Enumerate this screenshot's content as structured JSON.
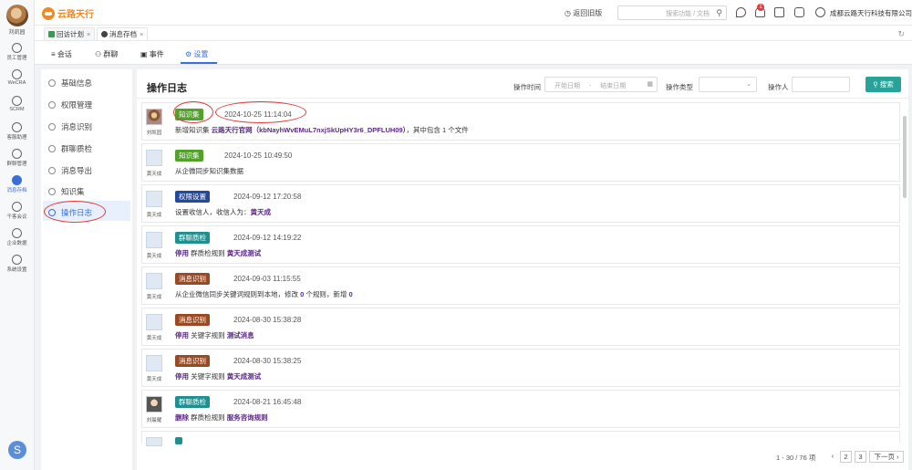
{
  "rail": {
    "user_name": "刘凯园",
    "items": [
      {
        "label": "员工管理",
        "icon": "user-icon"
      },
      {
        "label": "WeCRA",
        "icon": "wecra-icon"
      },
      {
        "label": "SCRM",
        "icon": "scrm-icon"
      },
      {
        "label": "客服助理",
        "icon": "service-icon"
      },
      {
        "label": "群聊管理",
        "icon": "group-icon"
      },
      {
        "label": "消息存档",
        "icon": "archive-icon"
      },
      {
        "label": "千客会议",
        "icon": "meeting-icon"
      },
      {
        "label": "企业数据",
        "icon": "data-icon"
      },
      {
        "label": "系统设置",
        "icon": "gear-icon"
      }
    ]
  },
  "topbar": {
    "brand": "云路天行",
    "return_label": "返回旧版",
    "search_placeholder": "搜索功能 / 文档",
    "notification_count": "1",
    "company": "成都云路天行科技有限公司"
  },
  "tabs": [
    {
      "label": "回访计划",
      "icon": "plan-icon",
      "active": false
    },
    {
      "label": "消息存档",
      "icon": "archive-icon",
      "active": true
    }
  ],
  "subnav": [
    {
      "label": "会话",
      "icon": "chat-icon"
    },
    {
      "label": "群聊",
      "icon": "group-icon"
    },
    {
      "label": "事件",
      "icon": "event-icon"
    },
    {
      "label": "设置",
      "icon": "gear-icon"
    }
  ],
  "menu": [
    {
      "label": "基础信息"
    },
    {
      "label": "权限管理"
    },
    {
      "label": "消息识别"
    },
    {
      "label": "群聊质检"
    },
    {
      "label": "消息导出"
    },
    {
      "label": "知识集"
    },
    {
      "label": "操作日志"
    }
  ],
  "main": {
    "title": "操作日志",
    "filter": {
      "time_label": "操作时间",
      "start_placeholder": "开始日期",
      "dash": "-",
      "end_placeholder": "结束日期",
      "type_label": "操作类型",
      "operator_label": "操作人",
      "search_button": "搜索"
    }
  },
  "entries": [
    {
      "name": "刘凯园",
      "tag": "知识集",
      "tag_color": "#52a22a",
      "time": "2024-10-25 11:14:04",
      "desc_pre": "新增知识集",
      "desc_em": "云路天行官网（kbNayhWvEMuL7nxjSkUpHY3r6_DPFLUH09）",
      "desc_post": "，其中包含 1 个文件"
    },
    {
      "name": "黄天成",
      "tag": "知识集",
      "tag_color": "#52a22a",
      "time": "2024-10-25 10:49:50",
      "desc_pre": "从企微同步知识集数据",
      "desc_em": "",
      "desc_post": ""
    },
    {
      "name": "黄天成",
      "tag": "权限设置",
      "tag_color": "#244a9c",
      "time": "2024-09-12 17:20:58",
      "desc_pre": "设置收信人，收信人为：",
      "desc_em": "黄天成",
      "desc_post": ""
    },
    {
      "name": "黄天成",
      "tag": "群聊质检",
      "tag_color": "#1f8f8f",
      "time": "2024-09-12 14:19:22",
      "desc_pre": "停用",
      "desc_em": "黄天成测试",
      "desc_post": "",
      "desc_mid": "群质检规则"
    },
    {
      "name": "黄天成",
      "tag": "消息识别",
      "tag_color": "#9a4a22",
      "time": "2024-09-03 11:15:55",
      "desc_pre": "从企业微信同步关键词规则到本地，修改",
      "desc_em": "0",
      "desc_post": "个规则，新增",
      "desc_em2": "0"
    },
    {
      "name": "黄天成",
      "tag": "消息识别",
      "tag_color": "#9a4a22",
      "time": "2024-08-30 15:38:28",
      "desc_pre": "停用",
      "desc_mid": "关键字规则",
      "desc_em": "测试消息",
      "desc_post": ""
    },
    {
      "name": "黄天成",
      "tag": "消息识别",
      "tag_color": "#9a4a22",
      "time": "2024-08-30 15:38:25",
      "desc_pre": "停用",
      "desc_mid": "关键字规则",
      "desc_em": "黄天成测试",
      "desc_post": ""
    },
    {
      "name": "刘晨耀",
      "tag": "群聊质检",
      "tag_color": "#1f8f8f",
      "time": "2024-08-21 16:45:48",
      "desc_pre": "删除",
      "desc_mid": "群质检规则",
      "desc_em": "服务咨询规则",
      "desc_post": ""
    }
  ],
  "pager": {
    "summary": "1 - 30 / 76 项",
    "pages": [
      "1",
      "2",
      "3"
    ],
    "next": "下一页"
  }
}
